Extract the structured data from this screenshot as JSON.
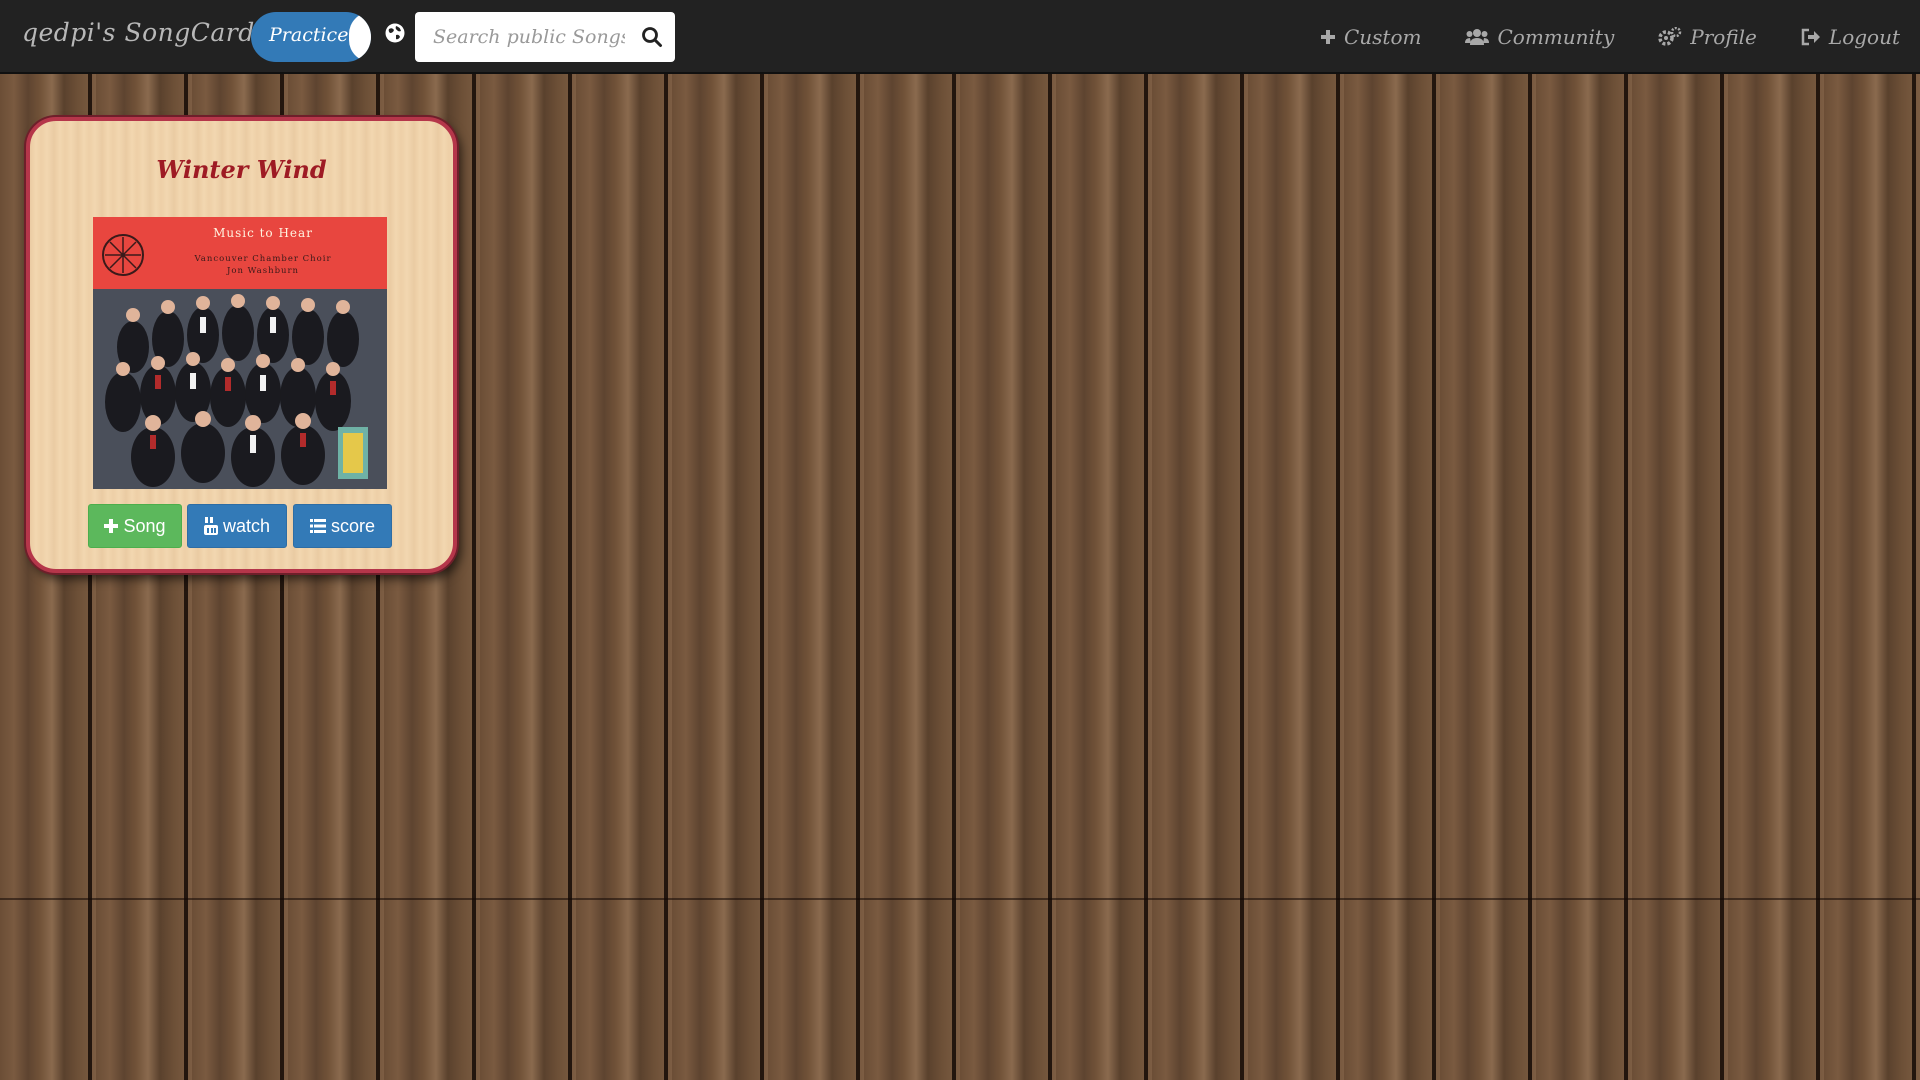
{
  "navbar": {
    "brand": "qedpi's SongCards",
    "mode_toggle_label": "Practice",
    "search_placeholder": "Search public Songs",
    "links": {
      "custom": "Custom",
      "community": "Community",
      "profile": "Profile",
      "logout": "Logout"
    }
  },
  "card": {
    "title": "Winter Wind",
    "album_cover": {
      "line1": "Music to Hear",
      "line2": "Vancouver Chamber Choir",
      "line3": "Jon Washburn"
    },
    "buttons": {
      "song": "Song",
      "watch": "watch",
      "score": "score"
    }
  },
  "colors": {
    "navbar_bg": "#222222",
    "primary": "#337ab7",
    "success": "#5cb85c",
    "card_border": "#b5364a",
    "card_title": "#9e1b24"
  },
  "icons": {
    "globe": "globe-icon",
    "search": "search-icon",
    "custom": "plus-icon",
    "community": "users-icon",
    "profile": "gears-icon",
    "logout": "sign-out-icon",
    "song": "plus-icon",
    "watch": "youtube-icon",
    "score": "list-icon"
  }
}
